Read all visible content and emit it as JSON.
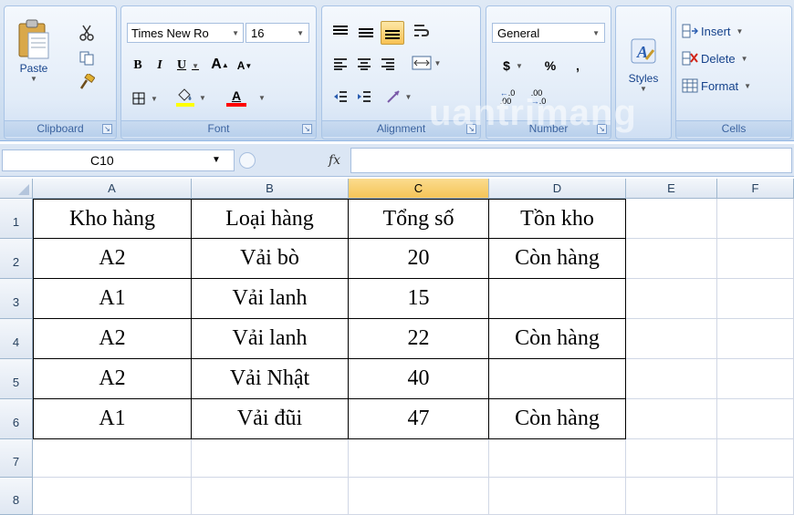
{
  "ribbon": {
    "clipboard": {
      "label": "Clipboard",
      "paste_label": "Paste",
      "cut_icon": "scissors-icon",
      "copy_icon": "copy-icon",
      "format_painter_icon": "format-painter-icon"
    },
    "font": {
      "label": "Font",
      "font_name": "Times New Ro",
      "font_size": "16",
      "bold": "B",
      "italic": "I",
      "underline": "U",
      "grow": "A",
      "shrink": "A",
      "font_color": "A",
      "highlight_color": "#ffff00",
      "font_color_value": "#ff0000"
    },
    "alignment": {
      "label": "Alignment"
    },
    "number": {
      "label": "Number",
      "format": "General",
      "currency": "$",
      "percent": "%",
      "comma": ",",
      "inc_decimal": ".0 .00",
      "dec_decimal": ".00 .0"
    },
    "styles": {
      "label": "Styles"
    },
    "cells": {
      "label": "Cells",
      "insert": "Insert",
      "delete": "Delete",
      "format": "Format"
    }
  },
  "formula_bar": {
    "name_box": "C10",
    "fx": "fx",
    "formula": ""
  },
  "watermark": "uantrimang",
  "grid": {
    "columns": [
      "A",
      "B",
      "C",
      "D",
      "E",
      "F"
    ],
    "selected_column": "C",
    "rows": [
      "1",
      "2",
      "3",
      "4",
      "5",
      "6",
      "7",
      "8"
    ],
    "cells": [
      [
        "Kho hàng",
        "Loại hàng",
        "Tổng số",
        "Tồn kho",
        "",
        ""
      ],
      [
        "A2",
        "Vải bò",
        "20",
        "Còn hàng",
        "",
        ""
      ],
      [
        "A1",
        "Vải lanh",
        "15",
        "",
        "",
        ""
      ],
      [
        "A2",
        "Vải lanh",
        "22",
        "Còn hàng",
        "",
        ""
      ],
      [
        "A2",
        "Vải Nhật",
        "40",
        "",
        "",
        ""
      ],
      [
        "A1",
        "Vải đũi",
        "47",
        "Còn hàng",
        "",
        ""
      ],
      [
        "",
        "",
        "",
        "",
        "",
        ""
      ],
      [
        "",
        "",
        "",
        "",
        "",
        ""
      ]
    ]
  }
}
